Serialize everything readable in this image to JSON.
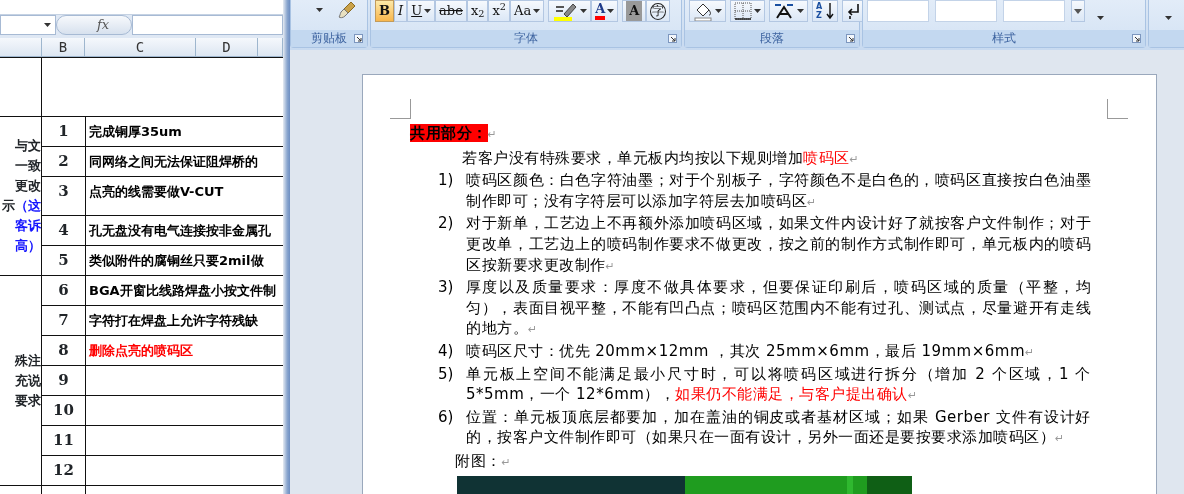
{
  "excel": {
    "formula_button": "fx",
    "column_headers": [
      "B",
      "C",
      "D"
    ],
    "groups": [
      {
        "label_lines": [
          [
            {
              "text": "与文",
              "accent": false
            }
          ],
          [
            {
              "text": "一致",
              "accent": false
            }
          ],
          [
            {
              "text": "更改",
              "accent": false
            }
          ],
          [
            {
              "text": "示",
              "accent": false
            },
            {
              "text": "（这",
              "accent": true
            }
          ],
          [
            {
              "text": "客诉",
              "accent": true
            }
          ],
          [
            {
              "text": "高）",
              "accent": true
            }
          ]
        ],
        "rows": [
          {
            "number": "1",
            "text": "完成铜厚35um",
            "accent": false
          },
          {
            "number": "2",
            "text": "同网络之间无法保证阻焊桥的",
            "accent": false
          },
          {
            "number": "3",
            "text": "点亮的线需要做V-CUT",
            "accent": false
          },
          {
            "number": "4",
            "text": "孔无盘没有电气连接按非金属孔",
            "accent": false
          },
          {
            "number": "5",
            "text": "类似附件的腐铜丝只要2mil做",
            "accent": false
          }
        ]
      },
      {
        "label_lines": [
          [
            {
              "text": "殊注",
              "accent": false
            }
          ],
          [
            {
              "text": "充说",
              "accent": false
            }
          ],
          [
            {
              "text": "要求",
              "accent": false
            }
          ]
        ],
        "rows": [
          {
            "number": "6",
            "text": "BGA开窗比线路焊盘小按文件制",
            "accent": false
          },
          {
            "number": "7",
            "text": "字符打在焊盘上允许字符残缺",
            "accent": false
          },
          {
            "number": "8",
            "text": "删除点亮的喷码区",
            "accent": true
          },
          {
            "number": "9"
          },
          {
            "number": "10"
          },
          {
            "number": "11"
          },
          {
            "number": "12"
          }
        ]
      }
    ]
  },
  "ribbon": {
    "groups": [
      {
        "label": "剪贴板",
        "launcher": true,
        "controls": [
          {
            "kind": "paste",
            "dropdown": true
          },
          {
            "kind": "brush",
            "dropdown": false
          }
        ]
      },
      {
        "label": "字体",
        "launcher": true,
        "controls": [
          {
            "kind": "bold",
            "text": "B",
            "selected": true,
            "dropdown": false
          },
          {
            "kind": "italic",
            "text": "I",
            "selected": false,
            "dropdown": false
          },
          {
            "kind": "underline",
            "text": "U",
            "selected": false,
            "dropdown": true
          },
          {
            "kind": "strike",
            "text": "abe",
            "selected": false,
            "dropdown": false
          },
          {
            "kind": "plain",
            "text": "x$_{2}$",
            "selected": false,
            "dropdown": false
          },
          {
            "kind": "plain",
            "text": "x$^{2}$",
            "selected": false,
            "dropdown": false
          },
          {
            "kind": "plain",
            "text": "Aa",
            "selected": false,
            "dropdown": true
          },
          {
            "kind": "separator"
          },
          {
            "kind": "highlighter",
            "color": "#ffff00",
            "dropdown": true
          },
          {
            "kind": "color-glyph",
            "text": "A",
            "color": "#ff0000",
            "dropdown": true
          },
          {
            "kind": "separator"
          },
          {
            "kind": "shaded",
            "text": "A",
            "selected": false,
            "dropdown": false
          },
          {
            "kind": "enclosed",
            "text": "字",
            "selected": false,
            "dropdown": false
          }
        ]
      },
      {
        "label": "段落",
        "launcher": true,
        "controls": [
          {
            "kind": "bucket",
            "dropdown": true
          },
          {
            "kind": "borders",
            "dropdown": true
          },
          {
            "kind": "layout",
            "dropdown": true
          },
          {
            "kind": "sort",
            "text": "AZ",
            "dropdown": false
          },
          {
            "kind": "marks",
            "dropdown": false
          }
        ]
      },
      {
        "label": "样式",
        "launcher": true,
        "controls": [
          {
            "kind": "gallery"
          },
          {
            "kind": "gallery"
          },
          {
            "kind": "gallery"
          },
          {
            "kind": "scroll"
          },
          {
            "kind": "caret"
          }
        ]
      },
      {
        "controls": [
          {
            "kind": "caret"
          }
        ]
      }
    ]
  },
  "document": {
    "heading": {
      "text": "共用部分：",
      "end_mark": "↵"
    },
    "intro": {
      "segments": [
        {
          "text": "若客户没有特殊要求，单元板内均按以下规则增加",
          "accent": false
        },
        {
          "text": "喷码区",
          "accent": true
        }
      ],
      "end_mark": "↵"
    },
    "items": [
      {
        "number": "1)",
        "segments": [
          {
            "text": "喷码区颜色：白色字符油墨；对于个别板子，字符颜色不是白色的，喷码区直接按白色油墨制作即可；没有字符层可以添加字符层去加喷码区",
            "accent": false
          }
        ],
        "end_mark": "↵"
      },
      {
        "number": "2)",
        "segments": [
          {
            "text": "对于新单，工艺边上不再额外添加喷码区域，如果文件内设计好了就按客户文件制作；对于更改单，工艺边上的喷码制作要求不做更改，按之前的制作方式制作即可，单元板内的喷码区按新要求更改制作",
            "accent": false
          }
        ],
        "end_mark": "↵"
      },
      {
        "number": "3)",
        "segments": [
          {
            "text": "厚度以及质量要求：厚度不做具体要求，但要保证印刷后，喷码区域的质量（平整，均匀），表面目视平整，不能有凹凸点；喷码区范围内不能有过孔、测试点，尽量避开有走线的地方。",
            "accent": false
          }
        ],
        "end_mark": "↵"
      },
      {
        "number": "4)",
        "segments": [
          {
            "text": "喷码区尺寸：优先 20mm×12mm ，其次 25mm×6mm，最后 19mm×6mm",
            "accent": false
          }
        ],
        "end_mark": "↵"
      },
      {
        "number": "5)",
        "segments": [
          {
            "text": "单元板上空间不能满足最小尺寸时，可以将喷码区域进行拆分（增加 2 个区域，1 个 5*5mm，一个 12*6mm），",
            "accent": false
          },
          {
            "text": "如果仍不能满足，与客户提出确认",
            "accent": true
          }
        ],
        "end_mark": "↵"
      },
      {
        "number": "6)",
        "segments": [
          {
            "text": "位置：单元板顶底层都要加，加在盖油的铜皮或者基材区域；如果 Gerber 文件有设计好的，按客户文件制作即可（如果只在一面有设计，另外一面还是要按要求添加喷码区）",
            "accent": false
          }
        ],
        "end_mark": "↵"
      }
    ],
    "figure_label": {
      "text": "附图：",
      "end_mark": "↵"
    }
  }
}
